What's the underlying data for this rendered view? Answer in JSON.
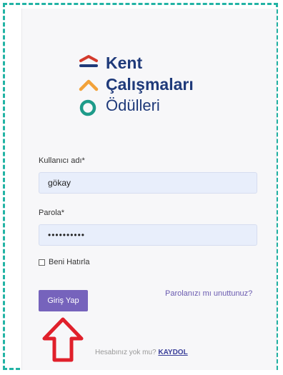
{
  "logo": {
    "line1": "Kent",
    "line2": "Çalışmaları",
    "line3": "Ödülleri"
  },
  "form": {
    "username_label": "Kullanıcı adı*",
    "username_value": "gökay",
    "password_label": "Parola*",
    "password_value": "••••••••••",
    "remember_label": "Beni Hatırla",
    "login_button": "Giriş Yap",
    "forgot_link": "Parolanızı mı unuttunuz?"
  },
  "footer": {
    "prompt": "Hesabınız yok mu?",
    "signup_link": "KAYDOL"
  },
  "colors": {
    "dashed_border": "#22b3a4",
    "button": "#7663bc",
    "arrow": "#e0202b",
    "logo_text": "#1f3a7a"
  },
  "icons": {
    "logo_marks": [
      "red-chevron",
      "orange-chevron",
      "green-circle"
    ],
    "annotation": "red-up-arrow"
  }
}
